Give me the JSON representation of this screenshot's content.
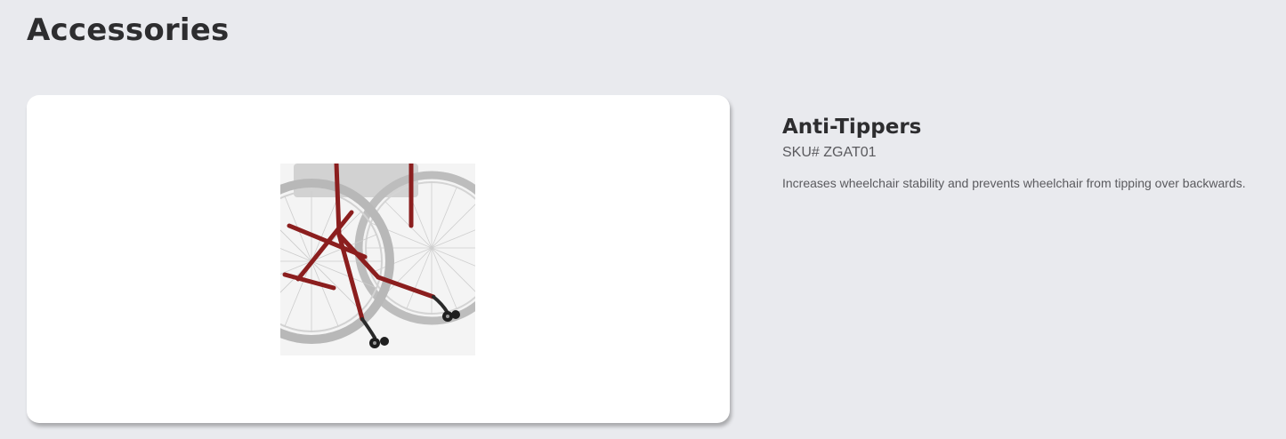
{
  "page": {
    "title": "Accessories"
  },
  "product": {
    "name": "Anti-Tippers",
    "sku": "SKU# ZGAT01",
    "description": "Increases wheelchair stability and prevents wheelchair from tipping over backwards.",
    "image_alt": "wheelchair-anti-tippers-photo"
  },
  "colors": {
    "background": "#e9eaee",
    "card": "#ffffff",
    "title_text": "#2d2d2f",
    "body_text": "#5a5a5e",
    "frame_red": "#8b1e1e"
  }
}
